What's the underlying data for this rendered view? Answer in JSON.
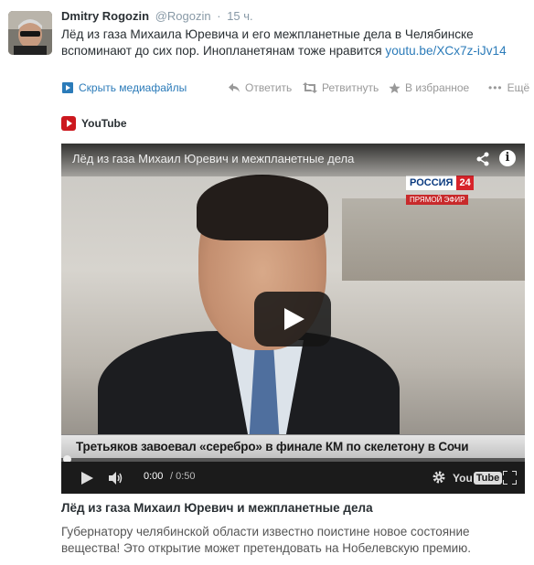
{
  "tweet": {
    "author_name": "Dmitry Rogozin",
    "author_handle": "@Rogozin",
    "separator": "·",
    "timestamp": "15 ч.",
    "text": "Лёд из газа Михаила Юревича и  его межпланетные дела в Челябинске вспоминают до сих пор. Инопланетянам тоже нравится ",
    "link_text": "youtu.be/XCx7z-iJv14",
    "actions": {
      "hide_media": "Скрыть медиафайлы",
      "reply": "Ответить",
      "retweet": "Ретвитнуть",
      "favorite": "В избранное",
      "more": "Ещё"
    }
  },
  "media": {
    "source_label": "YouTube",
    "player": {
      "title": "Лёд из газа Михаил Юревич и  межпланетные дела",
      "channel_logo_top": "РОССИЯ",
      "channel_logo_num": "24",
      "channel_logo_sub": "ПРЯМОЙ ЭФИР",
      "ticker": "Третьяков завоевал «серебро» в финале КМ по скелетону в Сочи",
      "time_current": "0:00",
      "time_duration": "/ 0:50",
      "logo_you": "You",
      "logo_tube": "Tube",
      "progress": 0
    },
    "headline": "Лёд из газа Михаил Юревич и межпланетные дела",
    "description": "Губернатору челябинской области известно поистине новое состояние вещества! Это открытие может претендовать на Нобелевскую премию."
  },
  "colors": {
    "link": "#2b7bb9",
    "muted": "#999999",
    "youtube_red": "#cc181e"
  }
}
